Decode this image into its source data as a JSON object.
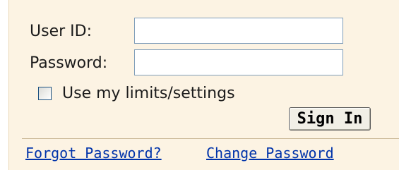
{
  "login_form": {
    "user_id_label": "User ID:",
    "user_id_value": "",
    "password_label": "Password:",
    "password_value": "",
    "remember_label": "Use my limits/settings",
    "remember_checked": false,
    "sign_in_label": "Sign In",
    "forgot_password_link": "Forgot Password?",
    "change_password_link": "Change Password"
  },
  "colors": {
    "panel_background": "#fcf3e3",
    "link": "#0033aa",
    "input_border": "#7f9db9"
  }
}
